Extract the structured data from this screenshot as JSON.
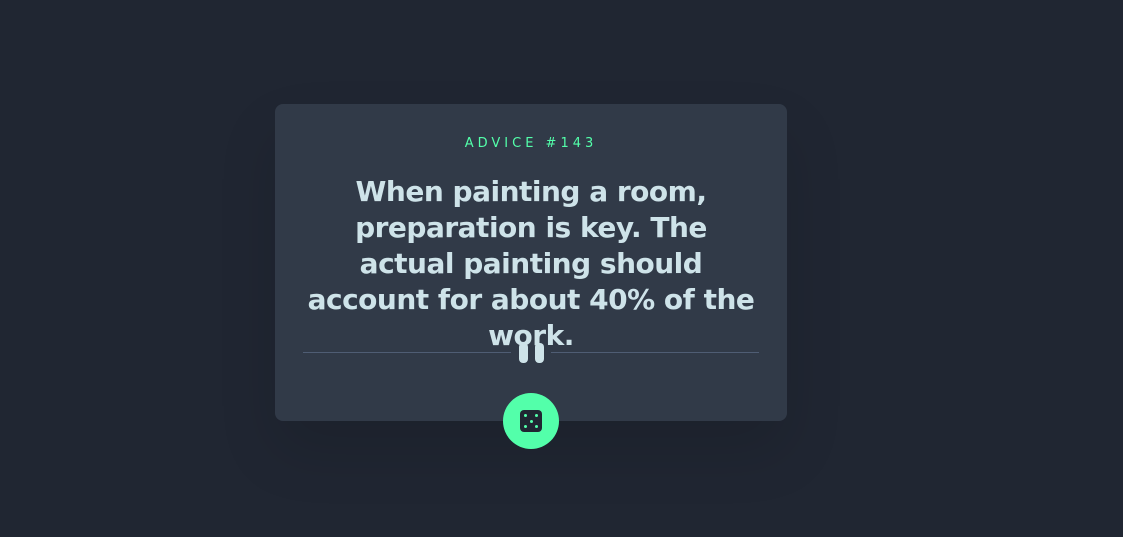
{
  "advice": {
    "label": "ADVICE #143",
    "text": "When painting a room, preparation is key. The actual painting should account for about 40% of the work."
  },
  "divider": {
    "icon": "pause-icon"
  },
  "button": {
    "icon": "dice-icon"
  },
  "colors": {
    "background": "#202632",
    "card": "#313a48",
    "accent": "#53ffaa",
    "text": "#cee3e9",
    "divider": "#4f5d74"
  }
}
